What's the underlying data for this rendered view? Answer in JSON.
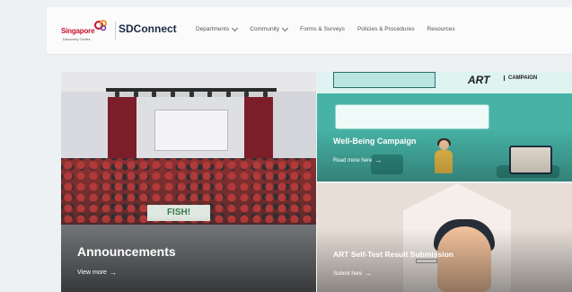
{
  "header": {
    "logo_text": "Singapore",
    "logo_sub": "Discovery Centre",
    "site_title": "SDConnect",
    "nav": [
      {
        "label": "Departments",
        "has_dropdown": true
      },
      {
        "label": "Community",
        "has_dropdown": true
      },
      {
        "label": "Forms & Surveys",
        "has_dropdown": false
      },
      {
        "label": "Policies & Procedures",
        "has_dropdown": false
      },
      {
        "label": "Resources",
        "has_dropdown": false
      }
    ]
  },
  "tiles": {
    "announcements": {
      "title": "Announcements",
      "link": "View more",
      "banner": "FISH!"
    },
    "wellbeing": {
      "title": "Well-Being Campaign",
      "link": "Read more here",
      "logo": "ART",
      "logo_tag": "CAMPAIGN"
    },
    "art": {
      "title": "ART Self-Test Result Submission",
      "link": "Submit here"
    }
  },
  "icons": {
    "arrow": "arrow-right-icon",
    "chevron": "chevron-down-icon"
  },
  "colors": {
    "brand_red": "#c8102e",
    "title_navy": "#1a2b44",
    "wellbeing_teal": "#47b3a6"
  }
}
